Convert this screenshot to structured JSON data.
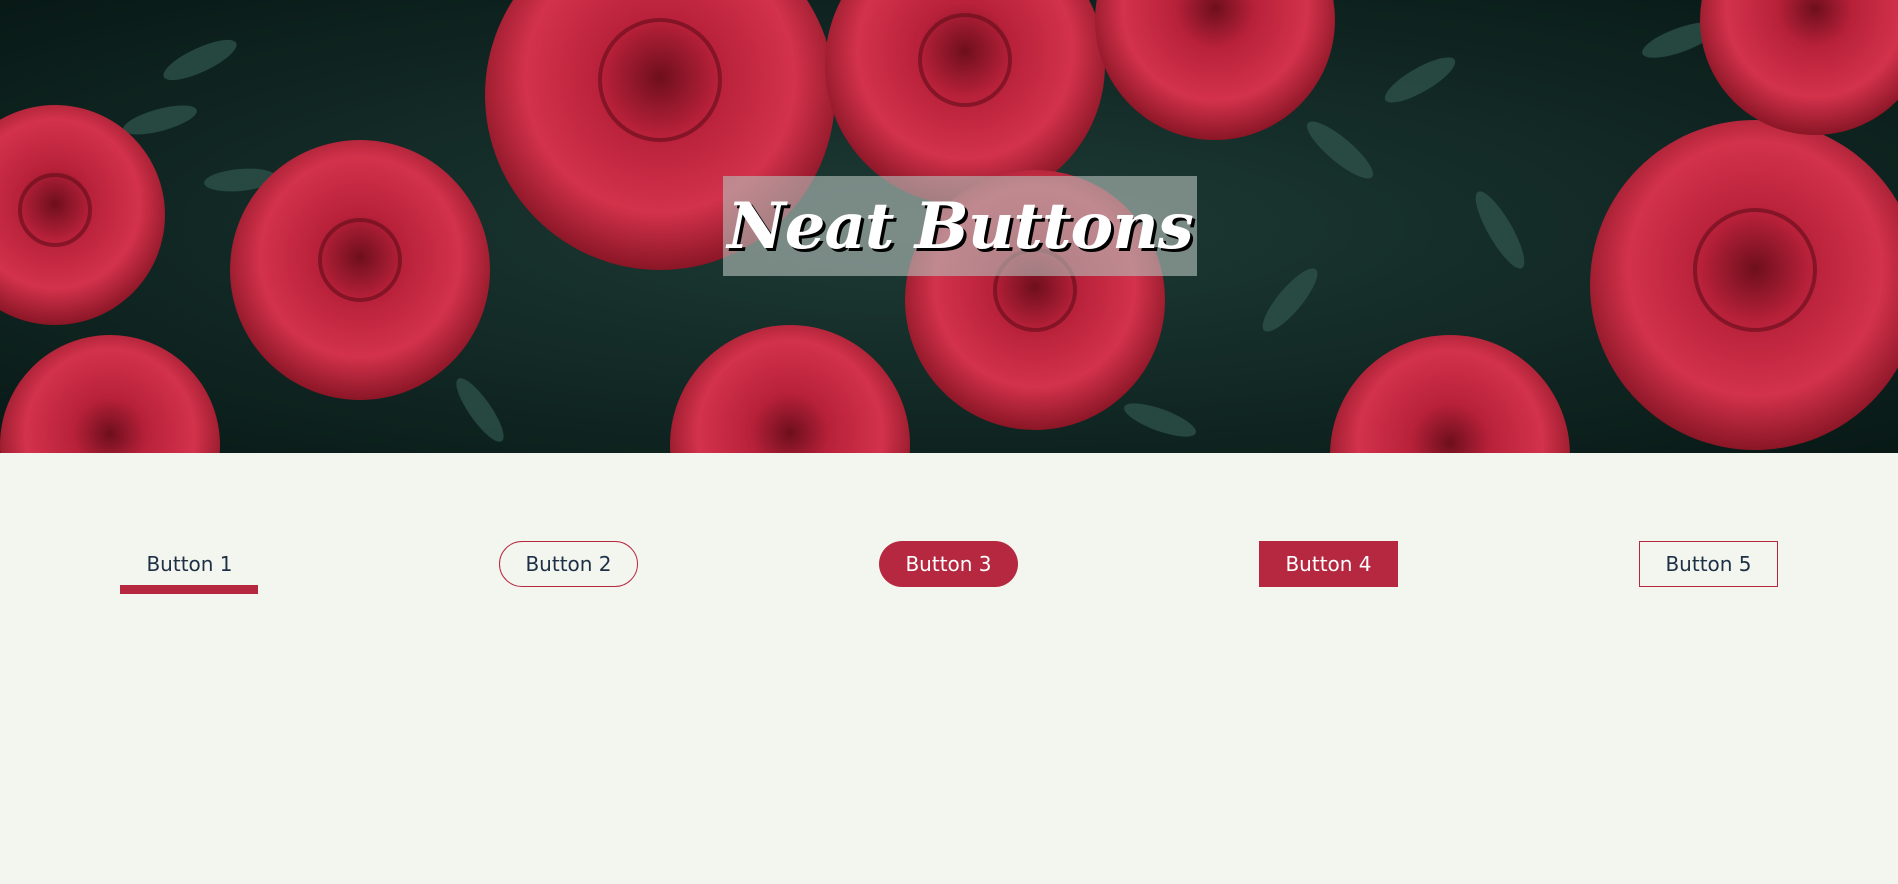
{
  "header": {
    "title": "Neat Buttons"
  },
  "buttons": [
    {
      "label": "Button 1",
      "style": "underline"
    },
    {
      "label": "Button 2",
      "style": "pill-outline"
    },
    {
      "label": "Button 3",
      "style": "pill-filled"
    },
    {
      "label": "Button 4",
      "style": "square-filled"
    },
    {
      "label": "Button 5",
      "style": "square-outline"
    }
  ],
  "colors": {
    "accent": "#b5283f",
    "text": "#1d3046",
    "background": "#f3f5ef",
    "hero_foliage": "#0d2421"
  }
}
